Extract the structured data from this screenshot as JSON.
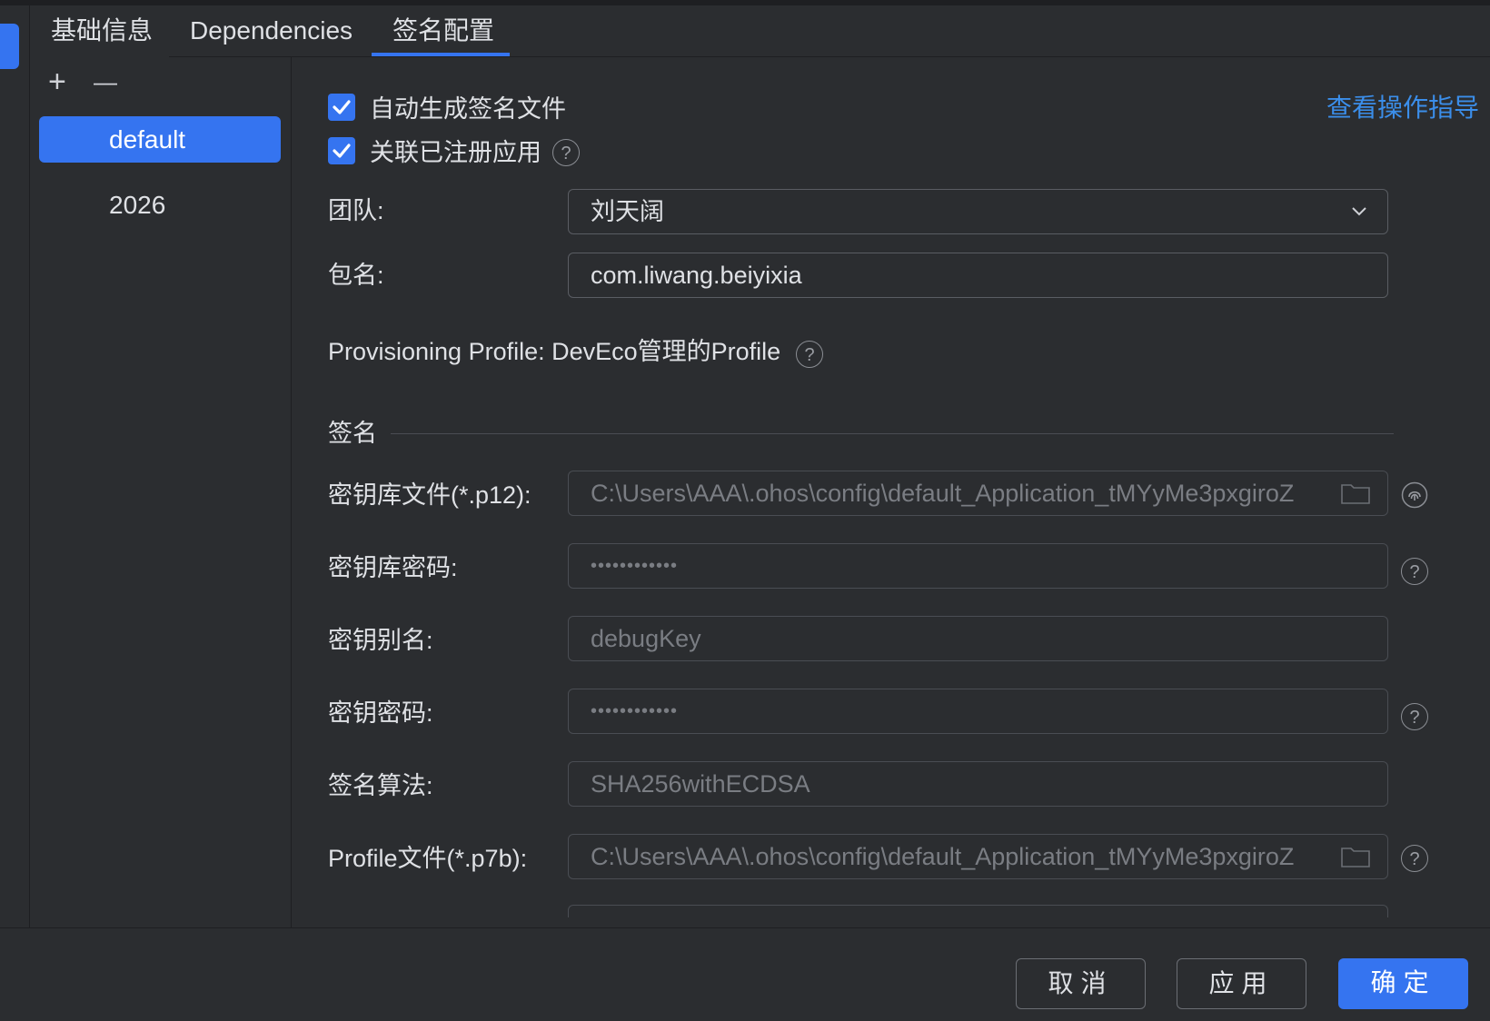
{
  "tabs": [
    {
      "label": "基础信息"
    },
    {
      "label": "Dependencies"
    },
    {
      "label": "签名配置"
    }
  ],
  "toolbar": {
    "add": "+",
    "remove": "—"
  },
  "configs": [
    {
      "label": "default",
      "selected": true
    },
    {
      "label": "2026",
      "selected": false
    }
  ],
  "options": {
    "auto_generate": {
      "label": "自动生成签名文件",
      "checked": true
    },
    "link_registered": {
      "label": "关联已注册应用",
      "checked": true
    }
  },
  "guide_link": "查看操作指导",
  "form": {
    "team": {
      "label": "团队:",
      "value": "刘天阔"
    },
    "bundle": {
      "label": "包名:",
      "value": "com.liwang.beiyixia"
    },
    "profile_info": "Provisioning Profile: DevEco管理的Profile",
    "sign_section": "签名",
    "keystore_file": {
      "label": "密钥库文件(*.p12):",
      "value": "C:\\Users\\AAA\\.ohos\\config\\default_Application_tMYyMe3pxgiroZ"
    },
    "keystore_password": {
      "label": "密钥库密码:",
      "value": "••••••••••••"
    },
    "key_alias": {
      "label": "密钥别名:",
      "value": "debugKey"
    },
    "key_password": {
      "label": "密钥密码:",
      "value": "••••••••••••"
    },
    "sign_algorithm": {
      "label": "签名算法:",
      "value": "SHA256withECDSA"
    },
    "profile_file": {
      "label": "Profile文件(*.p7b):",
      "value": "C:\\Users\\AAA\\.ohos\\config\\default_Application_tMYyMe3pxgiroZ"
    }
  },
  "help_glyph": "?",
  "buttons": {
    "cancel": "取消",
    "apply": "应用",
    "ok": "确定"
  },
  "colors": {
    "accent": "#3574f0",
    "link": "#3b8eea",
    "background": "#2b2d30"
  }
}
